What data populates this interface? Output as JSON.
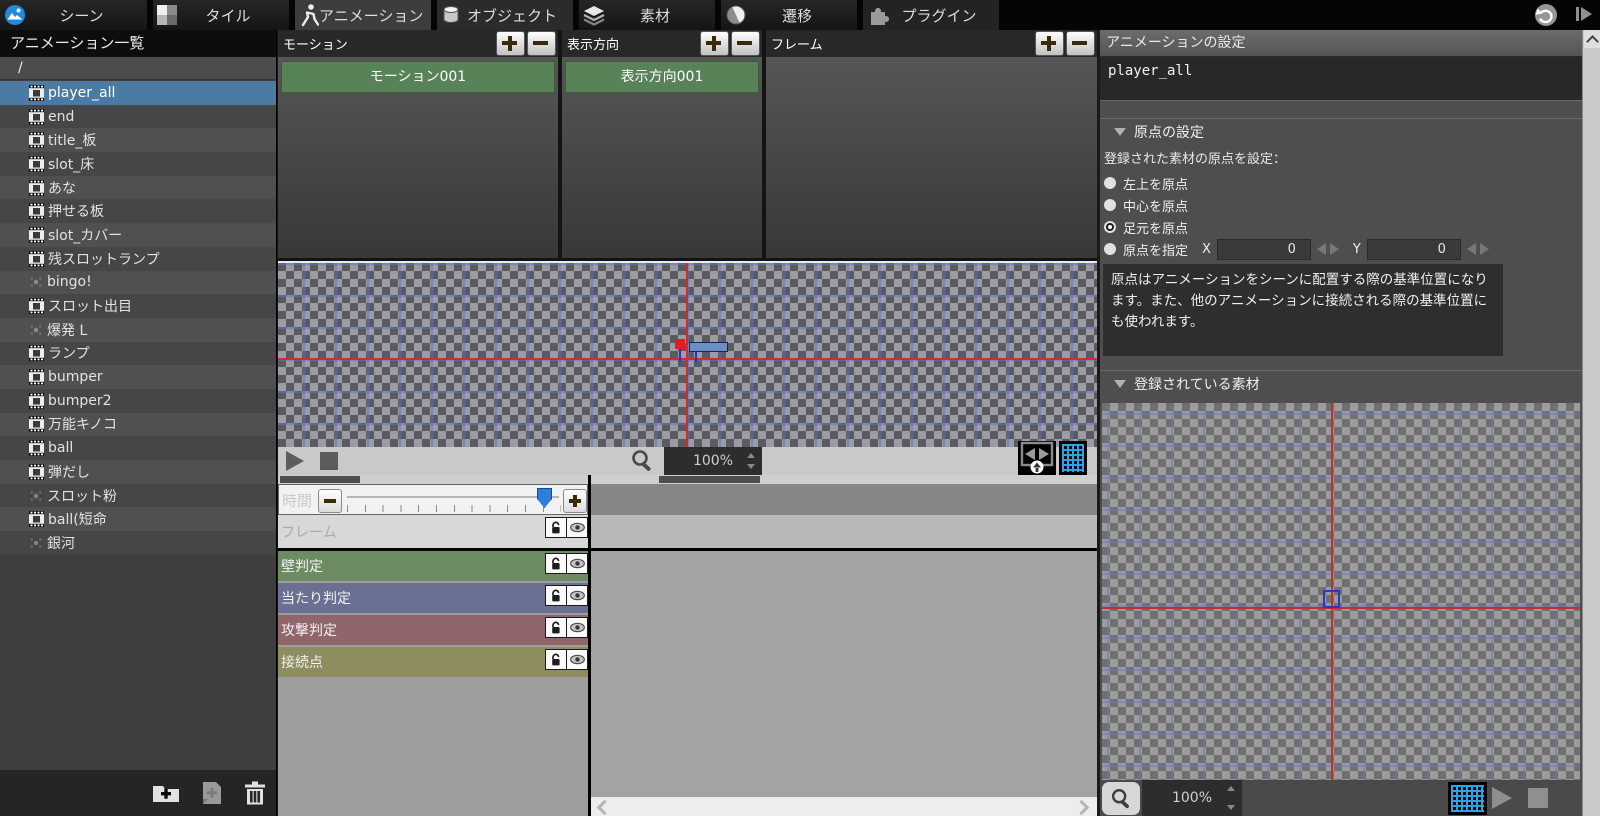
{
  "menu": {
    "tabs": [
      {
        "id": "scene",
        "label": "シーン",
        "active": false
      },
      {
        "id": "tile",
        "label": "タイル",
        "active": false
      },
      {
        "id": "animation",
        "label": "アニメーション",
        "active": true
      },
      {
        "id": "object",
        "label": "オブジェクト",
        "active": false
      },
      {
        "id": "material",
        "label": "素材",
        "active": false
      },
      {
        "id": "transition",
        "label": "遷移",
        "active": false
      },
      {
        "id": "plugin",
        "label": "プラグイン",
        "active": false
      }
    ]
  },
  "sidebar": {
    "title": "アニメーション一覧",
    "root": "/",
    "items": [
      {
        "label": "player_all",
        "icon": "film",
        "selected": true
      },
      {
        "label": "end",
        "icon": "film",
        "selected": false
      },
      {
        "label": "title_板",
        "icon": "film",
        "selected": false
      },
      {
        "label": "slot_床",
        "icon": "film",
        "selected": false
      },
      {
        "label": "あな",
        "icon": "film",
        "selected": false
      },
      {
        "label": "押せる板",
        "icon": "film",
        "selected": false
      },
      {
        "label": "slot_カバー",
        "icon": "film",
        "selected": false
      },
      {
        "label": "残スロットランプ",
        "icon": "film",
        "selected": false
      },
      {
        "label": "bingo!",
        "icon": "particle",
        "selected": false
      },
      {
        "label": "スロット出目",
        "icon": "film",
        "selected": false
      },
      {
        "label": "爆発 L",
        "icon": "particle",
        "selected": false
      },
      {
        "label": "ランプ",
        "icon": "film",
        "selected": false
      },
      {
        "label": "bumper",
        "icon": "film",
        "selected": false
      },
      {
        "label": "bumper2",
        "icon": "film",
        "selected": false
      },
      {
        "label": "万能キノコ",
        "icon": "film",
        "selected": false
      },
      {
        "label": "ball",
        "icon": "film",
        "selected": false
      },
      {
        "label": "弾だし",
        "icon": "film",
        "selected": false
      },
      {
        "label": "スロット粉",
        "icon": "particle",
        "selected": false
      },
      {
        "label": "ball(短命",
        "icon": "film",
        "selected": false
      },
      {
        "label": "銀河",
        "icon": "particle",
        "selected": false
      }
    ]
  },
  "motion_panel": {
    "title": "モーション",
    "items": [
      "モーション001"
    ]
  },
  "direction_panel": {
    "title": "表示方向",
    "items": [
      "表示方向001"
    ]
  },
  "frame_panel": {
    "title": "フレーム"
  },
  "canvas_toolbar": {
    "zoom": "100%"
  },
  "timeline": {
    "time_label": "時間",
    "rows": [
      {
        "label": "フレーム",
        "color": "#d8d8d8",
        "text_color": "#aaaaaa",
        "disabled": true
      },
      {
        "label": "壁判定",
        "color": "#6d8c64",
        "text_color": "#f2f2f2",
        "disabled": false
      },
      {
        "label": "当たり判定",
        "color": "#6a7094",
        "text_color": "#f2f2f2",
        "disabled": false
      },
      {
        "label": "攻撃判定",
        "color": "#91666b",
        "text_color": "#f2f2f2",
        "disabled": false
      },
      {
        "label": "接続点",
        "color": "#8d8d60",
        "text_color": "#f2f2f2",
        "disabled": false
      }
    ]
  },
  "settings": {
    "title": "アニメーションの設定",
    "name_value": "player_all",
    "origin_section": "原点の設定",
    "origin_label": "登録された素材の原点を設定：",
    "origin_options": [
      {
        "label": "左上を原点",
        "selected": false
      },
      {
        "label": "中心を原点",
        "selected": false
      },
      {
        "label": "足元を原点",
        "selected": true
      },
      {
        "label": "原点を指定",
        "selected": false
      }
    ],
    "x_label": "X",
    "x_value": "0",
    "y_label": "Y",
    "y_value": "0",
    "help": "原点はアニメーションをシーンに配置する際の基準位置になります。また、他のアニメーションに接続される際の基準位置にも使われます。",
    "materials_section": "登録されている素材",
    "zoom": "100%"
  },
  "colors": {
    "selection": "#4b7aa3",
    "motion_item_green": "#588258",
    "grid_blue": "#5f73c8",
    "guide_red": "#d42a2a",
    "slider_handle_blue": "#2e7fd9",
    "grid_toggle_blue": "#2aa3e8"
  },
  "icons": {
    "tabs": [
      "scene-icon",
      "tile-icon",
      "animation-icon",
      "object-icon",
      "material-icon",
      "transition-icon",
      "plugin-icon"
    ],
    "top_right": [
      "undo-icon",
      "step-forward-icon"
    ],
    "sidebar_items": [
      "film-icon",
      "particle-icon"
    ],
    "sidebar_toolbar": [
      "add-folder-icon",
      "add-animation-icon",
      "delete-icon"
    ],
    "playbar": [
      "play-icon",
      "stop-icon",
      "magnifier-icon",
      "zoom-spinner-icons",
      "fit-view-icon",
      "grid-toggle-icon"
    ],
    "timeline_rows": [
      "lock-icon",
      "eye-icon"
    ],
    "materials_toolbar": [
      "magnifier-icon",
      "grid-toggle-icon",
      "play-icon",
      "stop-icon"
    ],
    "scrollbars": [
      "scroll-up-icon",
      "scroll-left-icon",
      "scroll-right-icon"
    ]
  }
}
